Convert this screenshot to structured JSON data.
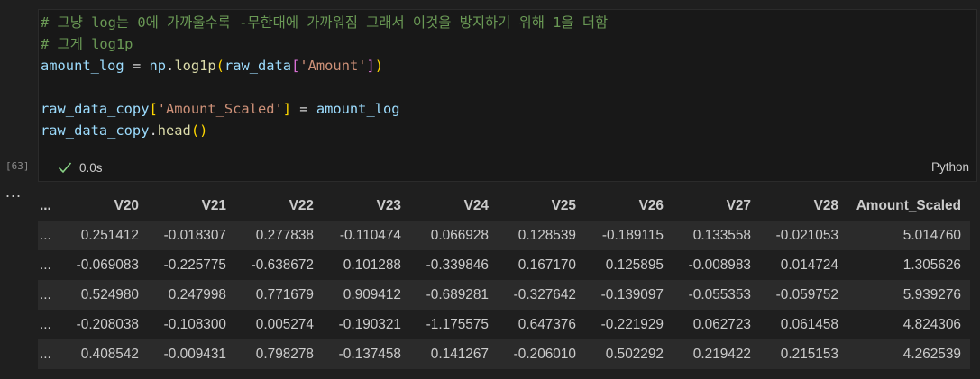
{
  "cell": {
    "execution_count": "[63]",
    "status_time": "0.0s",
    "language": "Python",
    "code_lines": [
      [
        {
          "t": "# 그냥 log는 0에 가까울수록 -무한대에 가까워짐 그래서 이것을 방지하기 위해 1을 더함",
          "c": "comment"
        }
      ],
      [
        {
          "t": "# 그게 log1p",
          "c": "comment"
        }
      ],
      [
        {
          "t": "amount_log",
          "c": "var"
        },
        {
          "t": " = ",
          "c": "op"
        },
        {
          "t": "np",
          "c": "var"
        },
        {
          "t": ".",
          "c": "op"
        },
        {
          "t": "log1p",
          "c": "fn"
        },
        {
          "t": "(",
          "c": "p1"
        },
        {
          "t": "raw_data",
          "c": "var"
        },
        {
          "t": "[",
          "c": "p2"
        },
        {
          "t": "'Amount'",
          "c": "str"
        },
        {
          "t": "]",
          "c": "p2"
        },
        {
          "t": ")",
          "c": "p1"
        }
      ],
      [],
      [
        {
          "t": "raw_data_copy",
          "c": "var"
        },
        {
          "t": "[",
          "c": "p1"
        },
        {
          "t": "'Amount_Scaled'",
          "c": "str"
        },
        {
          "t": "]",
          "c": "p1"
        },
        {
          "t": " = ",
          "c": "op"
        },
        {
          "t": "amount_log",
          "c": "var"
        }
      ],
      [
        {
          "t": "raw_data_copy",
          "c": "var"
        },
        {
          "t": ".",
          "c": "op"
        },
        {
          "t": "head",
          "c": "fn"
        },
        {
          "t": "()",
          "c": "p1"
        }
      ]
    ]
  },
  "colors": {
    "comment": "#6a9955",
    "var": "#9cdcfe",
    "op": "#d4d4d4",
    "fn": "#dcdcaa",
    "str": "#ce9178",
    "p1": "#ffd700",
    "p2": "#da70d6",
    "check": "#89d185"
  },
  "output": {
    "more_label": "...",
    "ellipsis": "...",
    "columns": [
      "V20",
      "V21",
      "V22",
      "V23",
      "V24",
      "V25",
      "V26",
      "V27",
      "V28",
      "Amount_Scaled"
    ],
    "rows": [
      [
        "0.251412",
        "-0.018307",
        "0.277838",
        "-0.110474",
        "0.066928",
        "0.128539",
        "-0.189115",
        "0.133558",
        "-0.021053",
        "5.014760"
      ],
      [
        "-0.069083",
        "-0.225775",
        "-0.638672",
        "0.101288",
        "-0.339846",
        "0.167170",
        "0.125895",
        "-0.008983",
        "0.014724",
        "1.305626"
      ],
      [
        "0.524980",
        "0.247998",
        "0.771679",
        "0.909412",
        "-0.689281",
        "-0.327642",
        "-0.139097",
        "-0.055353",
        "-0.059752",
        "5.939276"
      ],
      [
        "-0.208038",
        "-0.108300",
        "0.005274",
        "-0.190321",
        "-1.175575",
        "0.647376",
        "-0.221929",
        "0.062723",
        "0.061458",
        "4.824306"
      ],
      [
        "0.408542",
        "-0.009431",
        "0.798278",
        "-0.137458",
        "0.141267",
        "-0.206010",
        "0.502292",
        "0.219422",
        "0.215153",
        "4.262539"
      ]
    ]
  }
}
